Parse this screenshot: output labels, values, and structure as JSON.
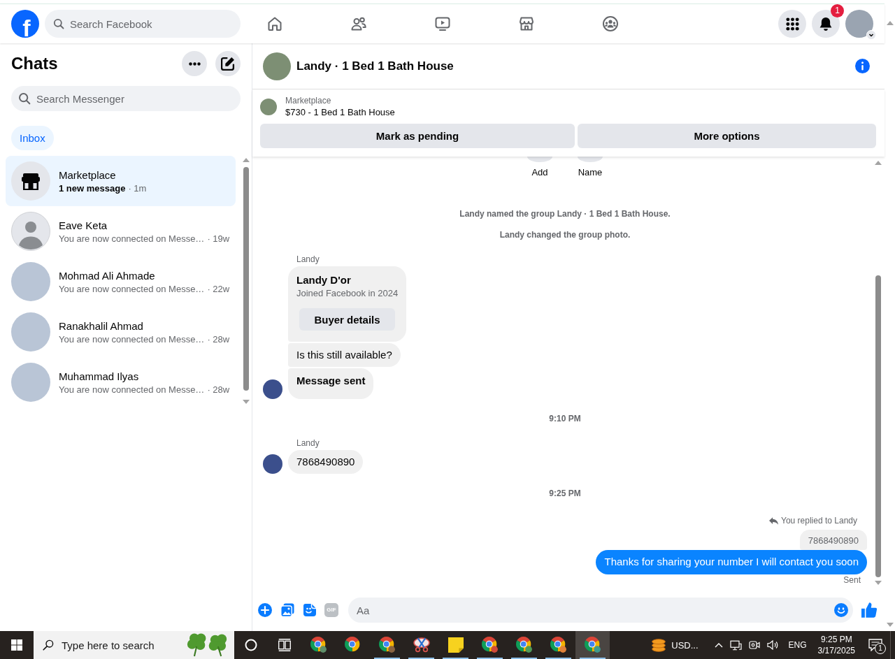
{
  "header": {
    "logo": "f",
    "search": {
      "placeholder": "Search Facebook"
    },
    "notifications": {
      "badge": "1"
    }
  },
  "sidebar": {
    "title": "Chats",
    "search": {
      "placeholder": "Search Messenger"
    },
    "filters": [
      {
        "label": "Inbox",
        "selected": true
      }
    ],
    "chats": [
      {
        "kind": "store",
        "name": "Marketplace",
        "preview": "1 new message",
        "time": "· 1m",
        "unread": true,
        "selected": true
      },
      {
        "kind": "silhouette",
        "name": "Eave Keta",
        "preview": "You are now connected on Messe…",
        "time": "· 19w",
        "unread": false,
        "selected": false
      },
      {
        "kind": "photo",
        "name": "Mohmad Ali Ahmade",
        "preview": "You are now connected on Messe…",
        "time": "· 22w",
        "unread": false,
        "selected": false
      },
      {
        "kind": "photo",
        "name": "Ranakhalil Ahmad",
        "preview": "You are now connected on Messe…",
        "time": "· 28w",
        "unread": false,
        "selected": false
      },
      {
        "kind": "photo",
        "name": "Muhammad Ilyas",
        "preview": "You are now connected on Messe…",
        "time": "· 28w",
        "unread": false,
        "selected": false
      }
    ]
  },
  "conversation": {
    "title": "Landy · 1 Bed 1 Bath House",
    "listing": {
      "source": "Marketplace",
      "title": "$730 - 1 Bed 1 Bath House",
      "actions": [
        {
          "label": "Mark as pending"
        },
        {
          "label": "More options"
        }
      ]
    },
    "group_actions": [
      {
        "label": "Add"
      },
      {
        "label": "Name"
      }
    ],
    "messages": [
      {
        "kind": "event",
        "text": "Landy named the group Landy · 1 Bed 1 Bath House."
      },
      {
        "kind": "event",
        "text": "Landy changed the group photo."
      },
      {
        "kind": "incoming",
        "sender": "Landy",
        "bubbles": [
          {
            "kind": "card",
            "title": "Landy D'or",
            "subtitle": "Joined Facebook in 2024",
            "button": "Buyer details"
          },
          {
            "kind": "text",
            "text": "Is this still available?"
          },
          {
            "kind": "notice",
            "text": "Message sent"
          }
        ]
      },
      {
        "kind": "time",
        "text": "9:10 PM"
      },
      {
        "kind": "incoming",
        "sender": "Landy",
        "bubbles": [
          {
            "kind": "text",
            "text": "7868490890"
          }
        ]
      },
      {
        "kind": "time",
        "text": "9:25 PM"
      },
      {
        "kind": "outgoing",
        "reply_note": "You replied to Landy",
        "quote": "7868490890",
        "text": "Thanks for sharing your number I will contact you soon",
        "status": "Sent"
      }
    ],
    "composer": {
      "placeholder": "Aa",
      "gif": "GIF"
    }
  },
  "taskbar": {
    "search": {
      "placeholder": "Type here to search"
    },
    "apps": [
      {
        "kind": "browser",
        "color": "#5f8f6a",
        "running": false,
        "selected": false
      },
      {
        "kind": "browser",
        "running": false,
        "selected": false
      },
      {
        "kind": "browser",
        "color": "#8a6442",
        "running": true,
        "selected": false
      },
      {
        "kind": "scissors",
        "running": true,
        "selected": false
      },
      {
        "kind": "notes",
        "running": true,
        "selected": false
      },
      {
        "kind": "browser",
        "color": "#d04a3a",
        "running": true,
        "selected": false
      },
      {
        "kind": "browser",
        "color": "#4f9a5a",
        "running": true,
        "selected": false
      },
      {
        "kind": "browser",
        "color": "#e0823a",
        "running": true,
        "selected": false
      },
      {
        "kind": "browser",
        "color": "#3f9a8e",
        "running": true,
        "selected": true
      }
    ],
    "tray": {
      "currency": "USD...",
      "language": "ENG",
      "time": "9:25 PM",
      "date": "3/17/2025",
      "notifications": "1"
    }
  }
}
